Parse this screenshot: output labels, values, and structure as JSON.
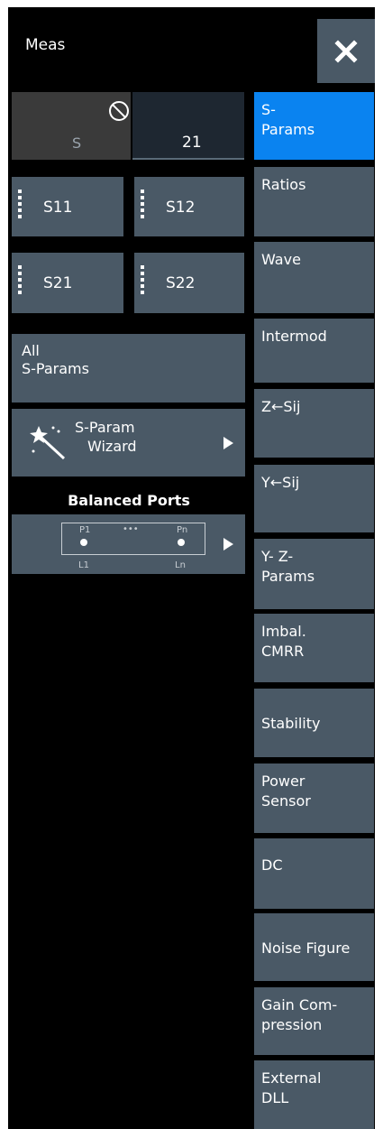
{
  "header": {
    "title": "Meas",
    "close_icon": "close-icon"
  },
  "sparam_selector": {
    "prefix": "S",
    "value": "21",
    "no_icon": "no-entry-icon"
  },
  "sparam_buttons": [
    "S11",
    "S12",
    "S21",
    "S22"
  ],
  "all_sparams": {
    "line1": "All",
    "line2": "S-Params"
  },
  "wizard": {
    "line1": "S-Param",
    "line2": "Wizard",
    "icon": "magic-wand-icon"
  },
  "balanced": {
    "title": "Balanced Ports",
    "p1": "P1",
    "dots": "•••",
    "pn": "Pn",
    "l1": "L1",
    "ln": "Ln"
  },
  "menu": [
    {
      "line1": "S-",
      "line2": "Params",
      "active": true
    },
    {
      "line1": "Ratios",
      "line2": ""
    },
    {
      "line1": "Wave",
      "line2": ""
    },
    {
      "line1": "Intermod",
      "line2": ""
    },
    {
      "line1": "Z←Sij",
      "line2": ""
    },
    {
      "line1": "Y←Sij",
      "line2": ""
    },
    {
      "line1": "Y- Z-",
      "line2": "Params"
    },
    {
      "line1": "Imbal.",
      "line2": "CMRR"
    },
    {
      "line1": "Stability",
      "line2": ""
    },
    {
      "line1": "Power",
      "line2": "Sensor"
    },
    {
      "line1": "DC",
      "line2": ""
    },
    {
      "line1": "Noise Figure",
      "line2": ""
    },
    {
      "line1": "Gain Com-",
      "line2": "pression"
    },
    {
      "line1": "External",
      "line2": "DLL"
    }
  ],
  "colors": {
    "button": "#4a5966",
    "active": "#0a83f0",
    "background": "#000000"
  }
}
